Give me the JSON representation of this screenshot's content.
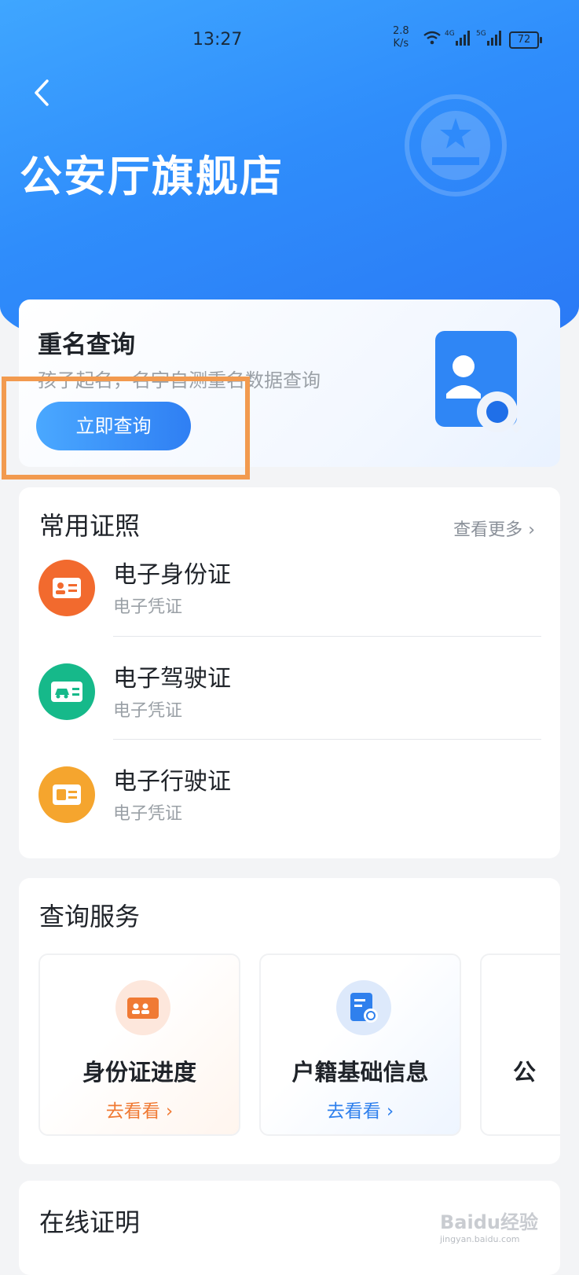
{
  "status_bar": {
    "time": "13:27",
    "net_speed_top": "2.8",
    "net_speed_bottom": "K/s",
    "sig1_label": "4G",
    "sig2_label": "5G",
    "battery": "72"
  },
  "header": {
    "title": "公安厅旗舰店"
  },
  "rename_card": {
    "title": "重名查询",
    "subtitle": "孩子起名，名字自测重名数据查询",
    "button": "立即查询"
  },
  "certificates": {
    "title": "常用证照",
    "more": "查看更多",
    "items": [
      {
        "name": "电子身份证",
        "desc": "电子凭证",
        "color": "#f26a2e",
        "icon": "id-card-icon"
      },
      {
        "name": "电子驾驶证",
        "desc": "电子凭证",
        "color": "#16b98a",
        "icon": "car-icon"
      },
      {
        "name": "电子行驶证",
        "desc": "电子凭证",
        "color": "#f5a52e",
        "icon": "vehicle-license-icon"
      }
    ]
  },
  "query_services": {
    "title": "查询服务",
    "items": [
      {
        "title": "身份证进度",
        "link": "去看看",
        "color": "#f07a34",
        "icon": "id-card-icon"
      },
      {
        "title": "户籍基础信息",
        "link": "去看看",
        "color": "#2f80ed",
        "icon": "household-search-icon"
      },
      {
        "title": "公",
        "link": "",
        "color": "#2f80ed",
        "icon": ""
      }
    ]
  },
  "online_cert": {
    "title": "在线证明"
  },
  "watermark": {
    "brand": "Baidu经验",
    "url": "jingyan.baidu.com"
  }
}
